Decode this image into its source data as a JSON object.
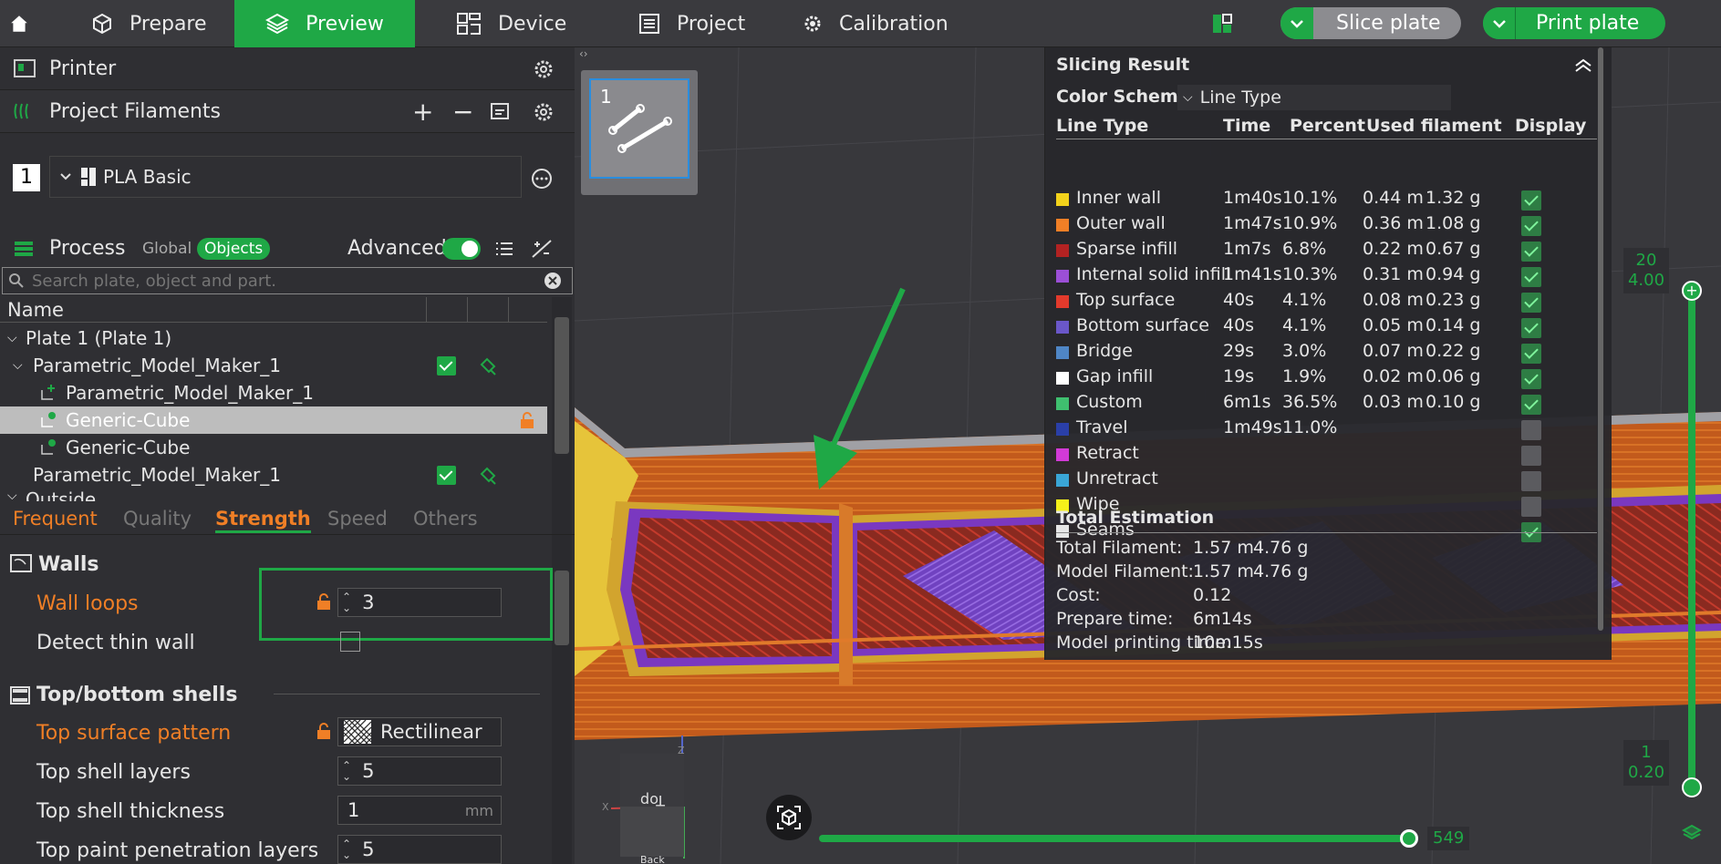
{
  "toolbar": {
    "prepare": "Prepare",
    "preview": "Preview",
    "device": "Device",
    "project": "Project",
    "calibration": "Calibration",
    "slice": "Slice plate",
    "print": "Print plate"
  },
  "sidebar": {
    "printer": "Printer",
    "filaments": "Project Filaments",
    "filament_index": "1",
    "filament_name": "PLA Basic",
    "process": "Process",
    "global": "Global",
    "objects": "Objects",
    "advanced": "Advanced",
    "search_placeholder": "Search plate, object and part."
  },
  "tree": {
    "col_name": "Name",
    "rows": [
      "Plate 1 (Plate 1)",
      "Parametric_Model_Maker_1",
      "Parametric_Model_Maker_1",
      "Generic-Cube",
      "Generic-Cube",
      "Parametric_Model_Maker_1",
      "Outside"
    ]
  },
  "tabs": [
    "Frequent",
    "Quality",
    "Strength",
    "Speed",
    "Others"
  ],
  "settings": {
    "walls": "Walls",
    "wall_loops": "Wall loops",
    "wall_loops_value": "3",
    "detect_thin": "Detect thin wall",
    "topbottom": "Top/bottom shells",
    "top_pattern": "Top surface pattern",
    "top_pattern_value": "Rectilinear",
    "top_layers": "Top shell layers",
    "top_layers_value": "5",
    "top_thickness": "Top shell thickness",
    "top_thickness_value": "1",
    "top_thickness_unit": "mm",
    "top_paint": "Top paint penetration layers",
    "top_paint_value": "5"
  },
  "plate_thumb": {
    "number": "1"
  },
  "slicing": {
    "title": "Slicing Result",
    "scheme_label": "Color Scheme",
    "scheme_value": "Line Type",
    "headers": [
      "Line Type",
      "Time",
      "Percent",
      "Used filament",
      "Display"
    ],
    "rows": [
      {
        "name": "Inner wall",
        "time": "1m40s",
        "pct": "10.1%",
        "len": "0.44 m",
        "g": "1.32 g",
        "color": "#f2d21b",
        "on": true
      },
      {
        "name": "Outer wall",
        "time": "1m47s",
        "pct": "10.9%",
        "len": "0.36 m",
        "g": "1.08 g",
        "color": "#f07f26",
        "on": true
      },
      {
        "name": "Sparse infill",
        "time": "1m7s",
        "pct": "6.8%",
        "len": "0.22 m",
        "g": "0.67 g",
        "color": "#b22222",
        "on": true
      },
      {
        "name": "Internal solid infill",
        "time": "1m41s",
        "pct": "10.3%",
        "len": "0.31 m",
        "g": "0.94 g",
        "color": "#9b4fd6",
        "on": true
      },
      {
        "name": "Top surface",
        "time": "40s",
        "pct": "4.1%",
        "len": "0.08 m",
        "g": "0.23 g",
        "color": "#e23a2c",
        "on": true
      },
      {
        "name": "Bottom surface",
        "time": "40s",
        "pct": "4.1%",
        "len": "0.05 m",
        "g": "0.14 g",
        "color": "#6a57c9",
        "on": true
      },
      {
        "name": "Bridge",
        "time": "29s",
        "pct": "3.0%",
        "len": "0.07 m",
        "g": "0.22 g",
        "color": "#4f86c6",
        "on": true
      },
      {
        "name": "Gap infill",
        "time": "19s",
        "pct": "1.9%",
        "len": "0.02 m",
        "g": "0.06 g",
        "color": "#ffffff",
        "on": true
      },
      {
        "name": "Custom",
        "time": "6m1s",
        "pct": "36.5%",
        "len": "0.03 m",
        "g": "0.10 g",
        "color": "#3fbf6f",
        "on": true
      },
      {
        "name": "Travel",
        "time": "1m49s",
        "pct": "11.0%",
        "len": "",
        "g": "",
        "color": "#2a3fa8",
        "on": false
      },
      {
        "name": "Retract",
        "time": "",
        "pct": "",
        "len": "",
        "g": "",
        "color": "#d23ad6",
        "on": false
      },
      {
        "name": "Unretract",
        "time": "",
        "pct": "",
        "len": "",
        "g": "",
        "color": "#3aa6d6",
        "on": false
      },
      {
        "name": "Wipe",
        "time": "",
        "pct": "",
        "len": "",
        "g": "",
        "color": "#f5f01a",
        "on": false
      },
      {
        "name": "Seams",
        "time": "",
        "pct": "",
        "len": "",
        "g": "",
        "color": "#e6e6e6",
        "on": true
      }
    ],
    "total_title": "Total Estimation",
    "totals": [
      {
        "k": "Total Filament:",
        "v": "1.57 m",
        "w": "4.76 g"
      },
      {
        "k": "Model Filament:",
        "v": "1.57 m",
        "w": "4.76 g"
      },
      {
        "k": "Cost:",
        "v": "0.12",
        "w": ""
      },
      {
        "k": "Prepare time:",
        "v": "6m14s",
        "w": ""
      },
      {
        "k": "Model printing time:",
        "v": "10m15s",
        "w": ""
      }
    ]
  },
  "layers": {
    "top_layer": "20",
    "top_height": "4.00",
    "bottom_layer": "1",
    "bottom_height": "0.20",
    "move_value": "549"
  },
  "nav_cube": {
    "top": "Top",
    "back": "Back",
    "axis_z": "Z",
    "axis_x": "X",
    "axis_y": "Y"
  }
}
